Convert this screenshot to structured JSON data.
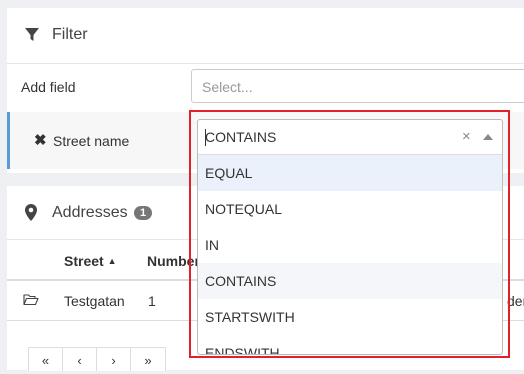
{
  "filter": {
    "title": "Filter",
    "add_field_label": "Add field",
    "add_field_placeholder": "Select...",
    "criterion_label": "Street name",
    "remove_symbol": "✖"
  },
  "operator_dropdown": {
    "value": "CONTAINS",
    "clear_symbol": "×",
    "options": [
      "EQUAL",
      "NOTEQUAL",
      "IN",
      "CONTAINS",
      "STARTSWITH",
      "ENDSWITH"
    ]
  },
  "addresses": {
    "title": "Addresses",
    "count": "1",
    "columns": [
      "Street",
      "Number"
    ],
    "rows": [
      {
        "street": "Testgatan",
        "number": "1",
        "extra": "den"
      }
    ]
  },
  "pagination": {
    "first": "«",
    "prev": "‹",
    "next": "›",
    "last": "»"
  },
  "colors": {
    "highlight": "#e0202a",
    "accent_bar": "#5b9bd5",
    "focused_option": "#eaf1fb"
  }
}
